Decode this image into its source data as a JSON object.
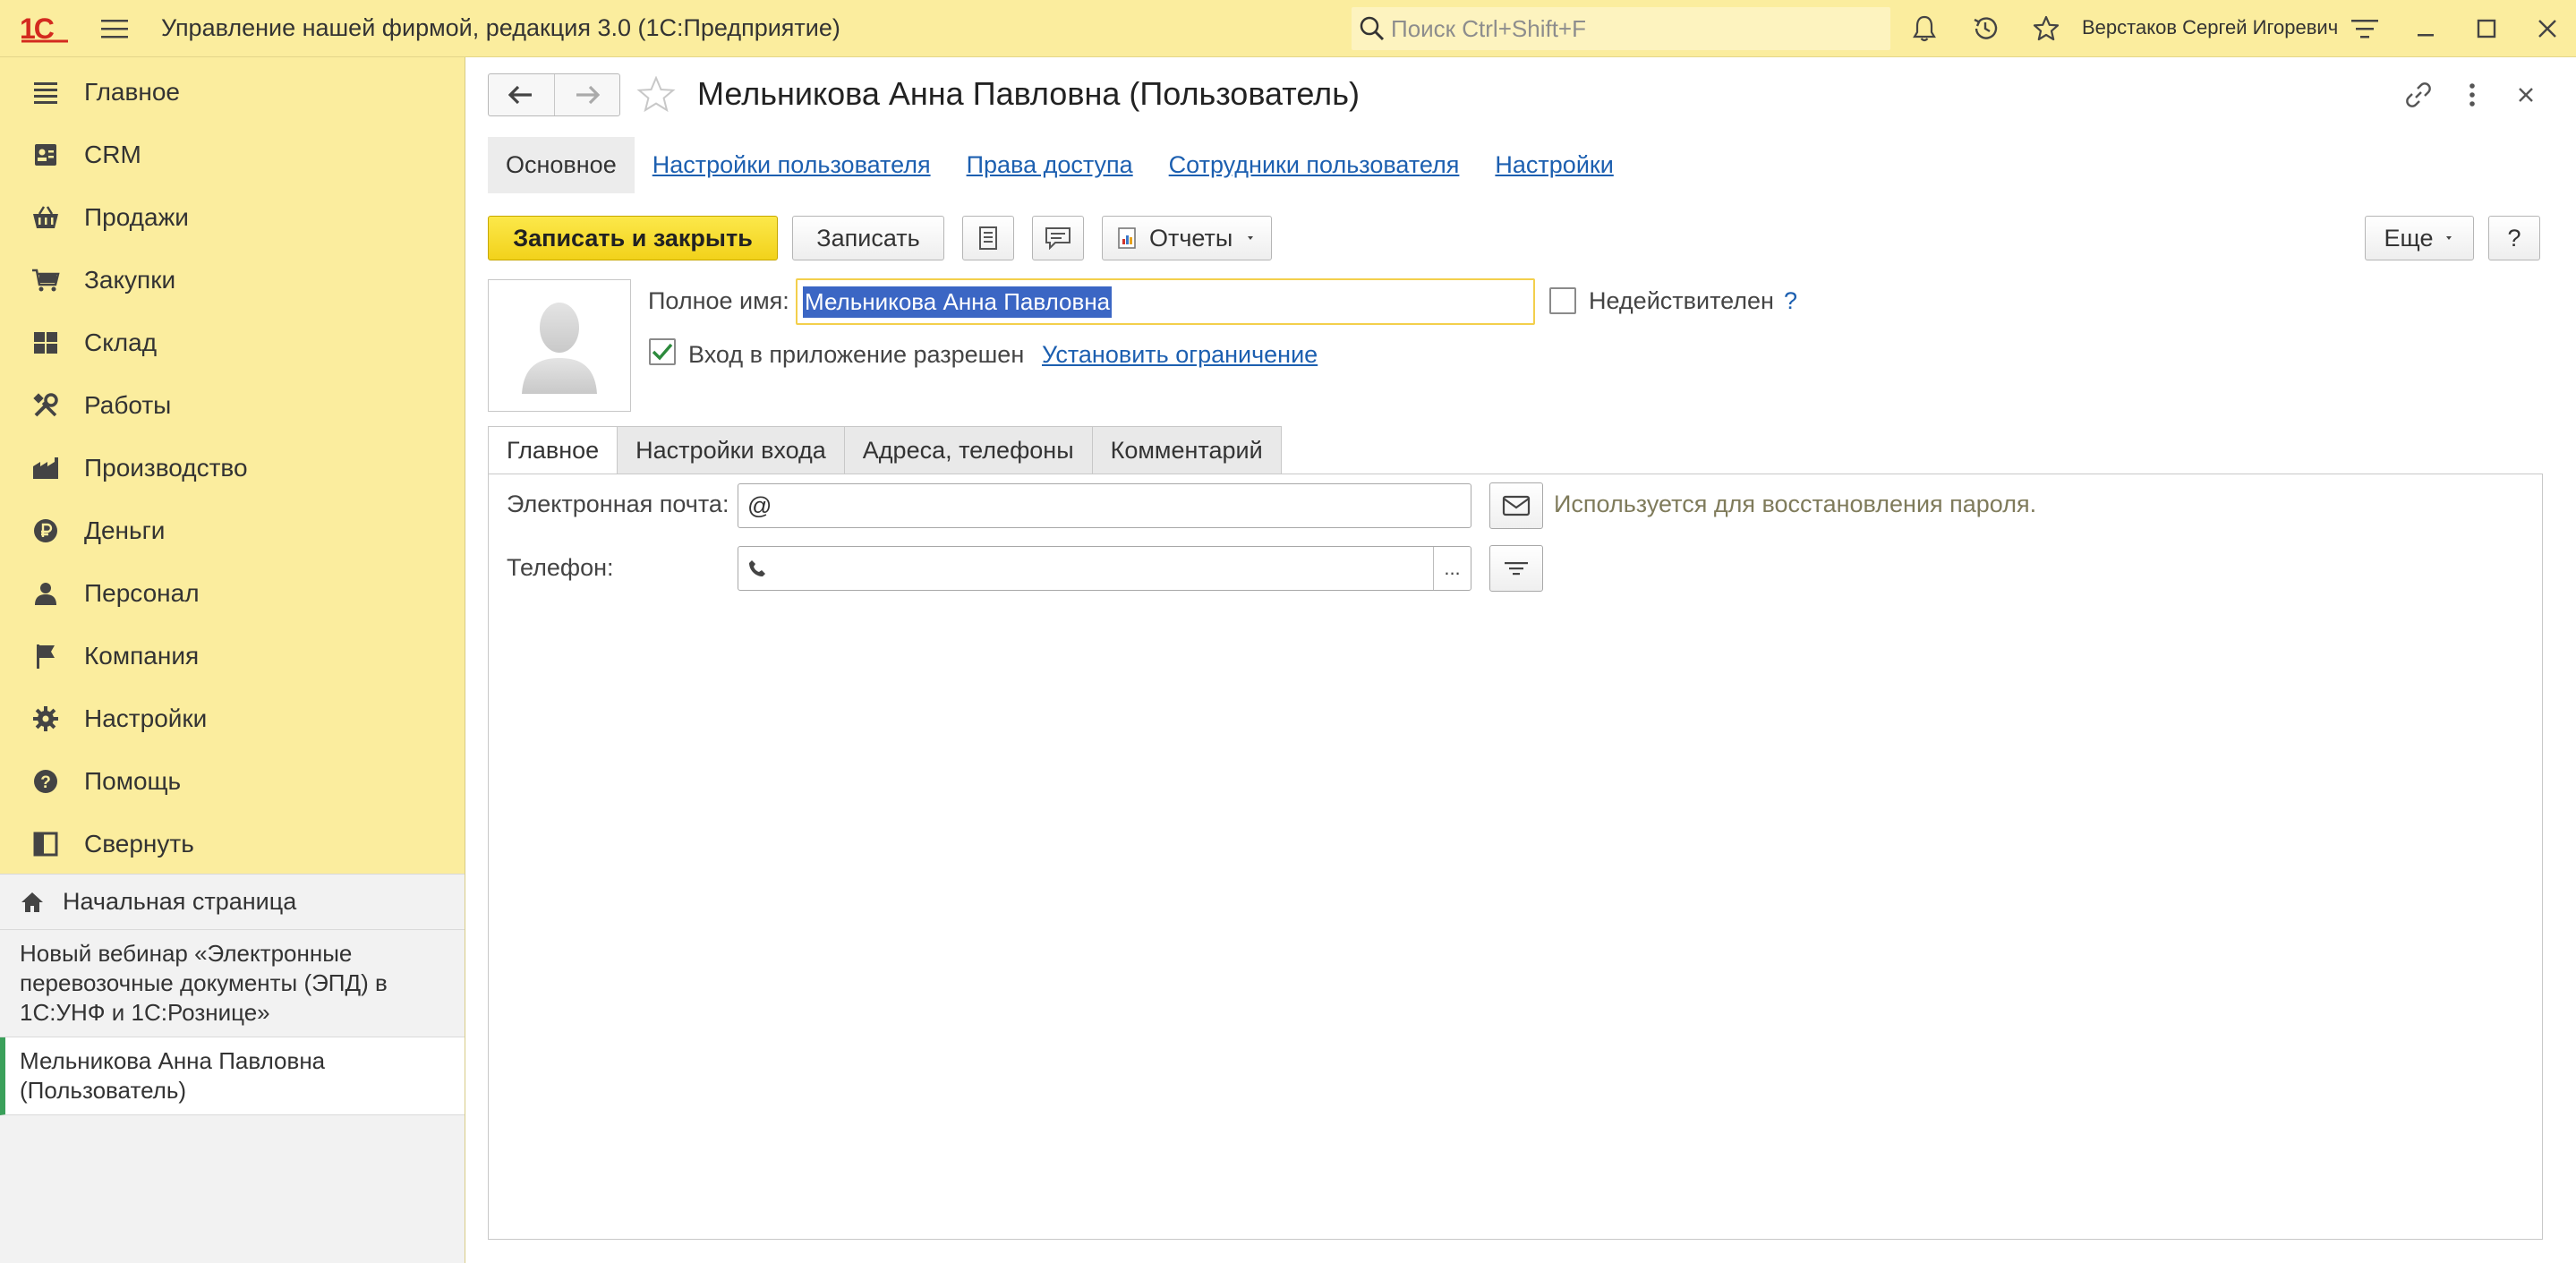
{
  "window": {
    "logo_text": "1С",
    "title": "Управление нашей фирмой, редакция 3.0  (1С:Предприятие)",
    "search_placeholder": "Поиск Ctrl+Shift+F",
    "user": "Верстаков Сергей Игоревич"
  },
  "sidebar": {
    "items": [
      {
        "label": "Главное",
        "icon": "list-icon"
      },
      {
        "label": "CRM",
        "icon": "contact-card-icon"
      },
      {
        "label": "Продажи",
        "icon": "basket-icon"
      },
      {
        "label": "Закупки",
        "icon": "cart-icon"
      },
      {
        "label": "Склад",
        "icon": "warehouse-icon"
      },
      {
        "label": "Работы",
        "icon": "tools-icon"
      },
      {
        "label": "Производство",
        "icon": "factory-icon"
      },
      {
        "label": "Деньги",
        "icon": "ruble-icon"
      },
      {
        "label": "Персонал",
        "icon": "person-icon"
      },
      {
        "label": "Компания",
        "icon": "flag-icon"
      },
      {
        "label": "Настройки",
        "icon": "gear-icon"
      },
      {
        "label": "Помощь",
        "icon": "help-icon"
      },
      {
        "label": "Свернуть",
        "icon": "collapse-panel-icon"
      }
    ],
    "home": "Начальная страница",
    "open_windows": [
      "Новый вебинар «Электронные перевозочные документы (ЭПД) в 1С:УНФ и 1С:Рознице»",
      "Мельникова Анна Павловна (Пользователь)"
    ]
  },
  "form": {
    "title": "Мельникова Анна Павловна (Пользователь)",
    "links": [
      "Основное",
      "Настройки пользователя",
      "Права доступа",
      "Сотрудники пользователя",
      "Настройки"
    ],
    "commands": {
      "save_close": "Записать и закрыть",
      "save": "Записать",
      "reports": "Отчеты",
      "more": "Еще",
      "help": "?"
    },
    "fullname_label": "Полное имя:",
    "fullname_value": "Мельникова Анна Павловна",
    "invalid_label": "Недействителен",
    "invalid_help": "?",
    "login_allowed_label": "Вход в приложение разрешен",
    "login_allowed": true,
    "set_restriction": "Установить ограничение",
    "tabs": [
      "Главное",
      "Настройки входа",
      "Адреса, телефоны",
      "Комментарий"
    ],
    "email_label": "Электронная почта:",
    "email_value": "@",
    "email_hint": "Используется для восстановления пароля.",
    "phone_label": "Телефон:",
    "phone_select": "..."
  },
  "colors": {
    "panel_yellow": "#fbed9e",
    "primary_button": "#f2d21b",
    "link_blue": "#1c5fb0",
    "selection": "#3b66c4"
  }
}
